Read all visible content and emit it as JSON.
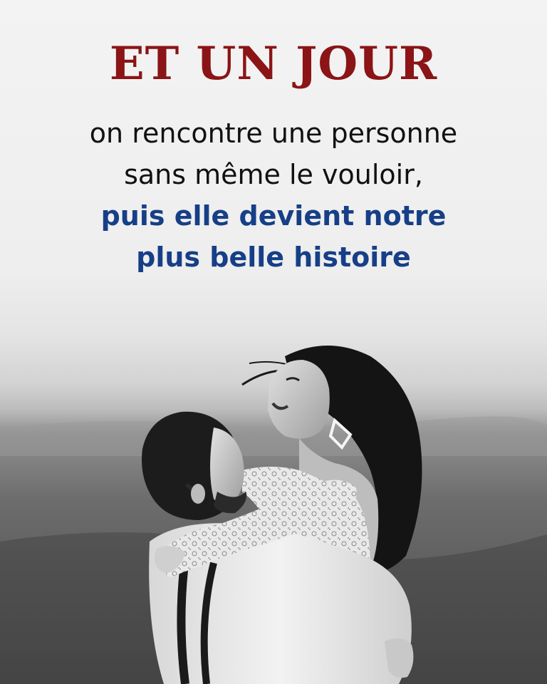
{
  "headline": "ET UN JOUR",
  "body_lines": [
    "on rencontre une personne",
    "sans même le vouloir,"
  ],
  "highlight_lines": [
    "puis elle devient notre",
    "plus belle histoire"
  ],
  "colors": {
    "headline": "#8b1416",
    "highlight": "#163f87",
    "body": "#111111"
  }
}
